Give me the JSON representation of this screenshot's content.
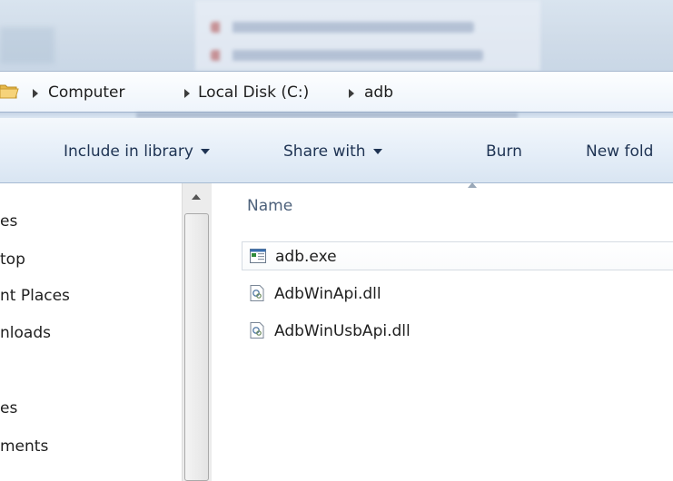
{
  "breadcrumb": {
    "items": [
      "Computer",
      "Local Disk (C:)",
      "adb"
    ]
  },
  "toolbar": {
    "include_in_library": "Include in library",
    "share_with": "Share with",
    "burn": "Burn",
    "new_folder": "New fold"
  },
  "nav": {
    "items": [
      "es",
      "top",
      "nt Places",
      "nloads",
      "es",
      "ments"
    ]
  },
  "files": {
    "column_name": "Name",
    "rows": [
      {
        "name": "adb.exe",
        "icon": "exe-icon"
      },
      {
        "name": "AdbWinApi.dll",
        "icon": "dll-icon"
      },
      {
        "name": "AdbWinUsbApi.dll",
        "icon": "dll-icon"
      }
    ]
  },
  "colors": {
    "toolbar_text": "#1e3353",
    "header_text": "#4c607a"
  }
}
